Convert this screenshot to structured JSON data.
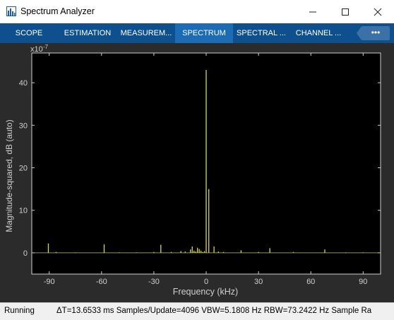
{
  "window": {
    "title": "Spectrum Analyzer",
    "minimize_icon": "minimize-icon",
    "maximize_icon": "maximize-icon",
    "close_icon": "close-icon"
  },
  "tabs": [
    {
      "label": "SCOPE",
      "active": false
    },
    {
      "label": "ESTIMATION",
      "active": false
    },
    {
      "label": "MEASUREM...",
      "active": false
    },
    {
      "label": "SPECTRUM",
      "active": true
    },
    {
      "label": "SPECTRAL ...",
      "active": false
    },
    {
      "label": "CHANNEL ...",
      "active": false
    }
  ],
  "more_button": {
    "label": "•••"
  },
  "chart_data": {
    "type": "line",
    "title": "",
    "xlabel": "Frequency (kHz)",
    "ylabel": "Magnitude-squared, dB (auto)",
    "y_exponent_label": "x10",
    "y_exponent": "-7",
    "xlim": [
      -100,
      100
    ],
    "ylim": [
      -5,
      47
    ],
    "x_ticks": [
      -90,
      -60,
      -30,
      0,
      30,
      60,
      90
    ],
    "x_tick_labels": [
      "-90",
      "-60",
      "-30",
      "0",
      "30",
      "60",
      "90"
    ],
    "y_ticks": [
      0,
      10,
      20,
      30,
      40
    ],
    "y_tick_labels": [
      "0",
      "10",
      "20",
      "30",
      "40"
    ],
    "grid": false,
    "colors": {
      "background": "#000000",
      "trace": "#d9d94a",
      "axes": "#cfcfcf"
    },
    "series": [
      {
        "x": [
          -90.5,
          -86,
          -75,
          -58.5,
          -50,
          -40,
          -30,
          -26,
          -20,
          -14.5,
          -12,
          -9,
          -8,
          -7,
          -6,
          -5,
          -4,
          -3,
          -2,
          -1,
          0,
          1.5,
          4.5,
          7,
          10,
          20,
          30,
          36.5,
          50,
          68,
          80,
          90
        ],
        "y": [
          2.2,
          0.2,
          0.1,
          2.0,
          0.1,
          0.1,
          0.2,
          1.9,
          0.2,
          0.4,
          0.3,
          0.8,
          1.5,
          0.5,
          0.3,
          1.2,
          0.9,
          0.5,
          0.2,
          0.4,
          43,
          15,
          1.5,
          0.3,
          0.2,
          0.6,
          0.2,
          1.1,
          0.2,
          0.8,
          0.1,
          0.1
        ]
      }
    ]
  },
  "status": {
    "state": "Running",
    "details": "ΔT=13.6533 ms  Samples/Update=4096  VBW=5.1808 Hz  RBW=73.2422 Hz  Sample Ra"
  }
}
